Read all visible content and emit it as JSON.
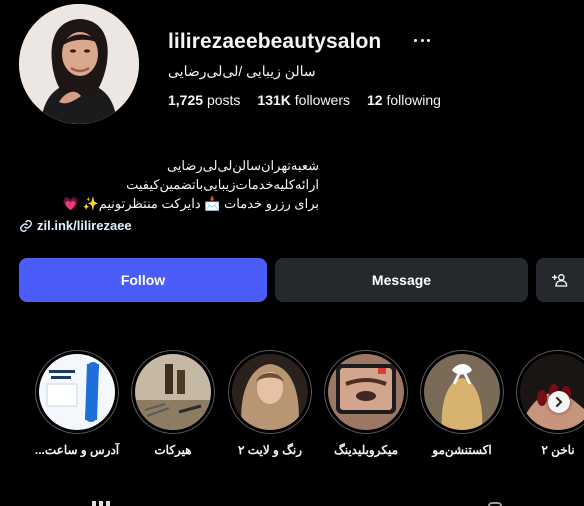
{
  "profile": {
    "username": "lilirezaeebeautysalon",
    "full_name": "سالن زیبایی /لی‌لی‌رضایی",
    "stats": {
      "posts_count": "1,725",
      "posts_label": "posts",
      "followers_count": "131K",
      "followers_label": "followers",
      "following_count": "12",
      "following_label": "following"
    },
    "bio": [
      "شعبه‌تهران‌سالن‌لی‌لی‌رضایی",
      "ارائه‌کلیه‌خدمات‌زیبایی‌باتضمین‌کیفیت",
      "برای رزرو خدمات 📩 دایرکت منتظرتونیم✨ 💗"
    ],
    "link_text": "zil.ink/lilirezaee"
  },
  "actions": {
    "follow_label": "Follow",
    "message_label": "Message"
  },
  "highlights": [
    {
      "label": "آدرس و ساعت..."
    },
    {
      "label": "هیرکات"
    },
    {
      "label": "رنگ و لایت ۲"
    },
    {
      "label": "میکروبلیدینگ"
    },
    {
      "label": "اکستنشن‌مو"
    },
    {
      "label": "ناخن ۲"
    }
  ],
  "colors": {
    "background": "#000000",
    "follow_button": "#4a5df9",
    "secondary_button": "#25292e",
    "link_text": "#e0f1ff"
  }
}
